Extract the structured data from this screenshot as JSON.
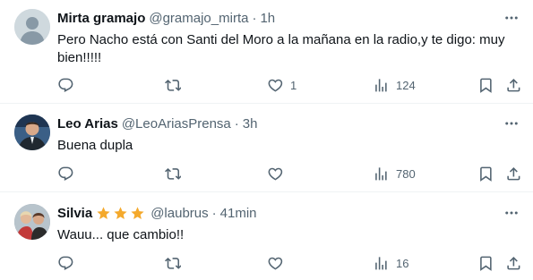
{
  "tweets": [
    {
      "name": "Mirta gramajo",
      "handle": "@gramajo_mirta",
      "separator": "·",
      "time": "1h",
      "text": "Pero Nacho está con Santi del Moro a la mañana en la radio,y te digo: muy bien!!!!!",
      "counts": {
        "reply": "",
        "retweet": "",
        "like": "1",
        "views": "124"
      }
    },
    {
      "name": "Leo Arias",
      "handle": "@LeoAriasPrensa",
      "separator": "·",
      "time": "3h",
      "text": "Buena dupla",
      "counts": {
        "reply": "",
        "retweet": "",
        "like": "",
        "views": "780"
      }
    },
    {
      "name": "Silvia",
      "stars": [
        "star-icon",
        "star-icon",
        "star-icon"
      ],
      "handle": "@laubrus",
      "separator": "·",
      "time": "41min",
      "text": "Wauu... que cambio!!",
      "counts": {
        "reply": "",
        "retweet": "",
        "like": "",
        "views": "16"
      }
    }
  ],
  "colors": {
    "text": "#0f1419",
    "secondary": "#536471",
    "divider": "#eff3f4",
    "star": "#f4a92c"
  }
}
